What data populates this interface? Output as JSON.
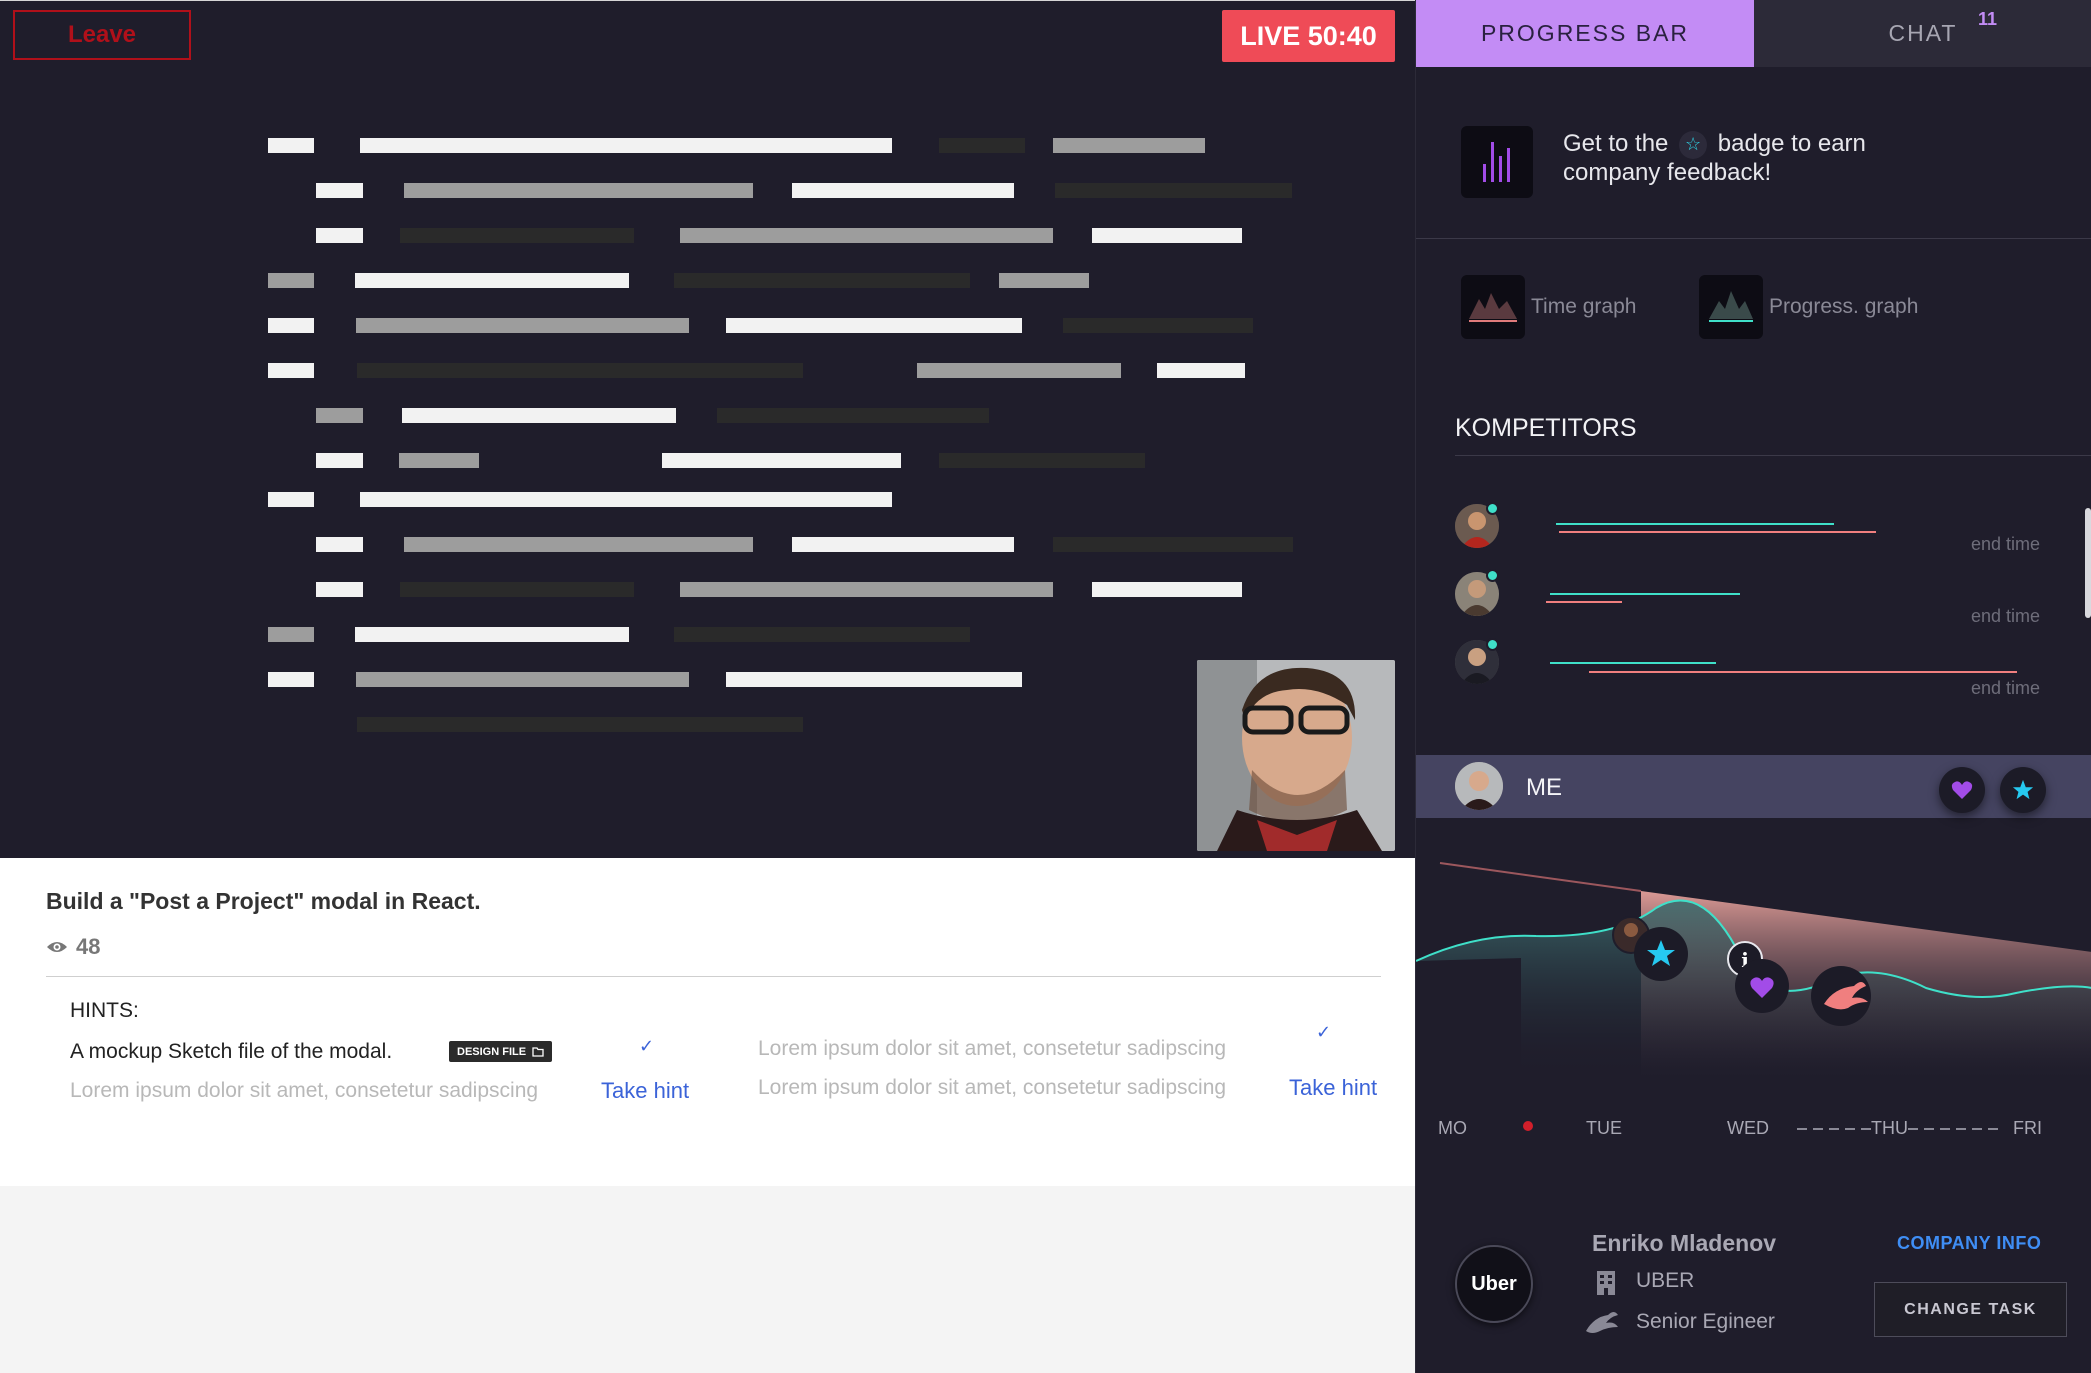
{
  "header": {
    "leave_label": "Leave",
    "live_label": "LIVE 50:40"
  },
  "task": {
    "title": "Build a \"Post a Project\" modal in React.",
    "views": "48",
    "hints_label": "HINTS:",
    "hint_main": "A mockup Sketch file of the modal.",
    "design_chip": "DESIGN FILE",
    "hint_muted_1": "Lorem ipsum dolor sit amet, consetetur sadipscing",
    "hint_muted_2": "Lorem ipsum dolor sit amet, consetetur sadipscing",
    "hint_muted_3": "Lorem ipsum dolor sit amet, consetetur sadipscing",
    "take_hint_1": "Take hint",
    "take_hint_2": "Take hint"
  },
  "sidebar": {
    "tabs": [
      {
        "label": "PROGRESS BAR"
      },
      {
        "label": "CHAT",
        "count": "11"
      }
    ],
    "promo_before": "Get to the",
    "promo_after": "badge to earn company feedback!",
    "graphs": [
      {
        "label": "Time graph"
      },
      {
        "label": "Progress. graph"
      }
    ],
    "competitors_title": "KOMPETITORS",
    "competitors": [
      {
        "end_label": "end time"
      },
      {
        "end_label": "end time"
      },
      {
        "end_label": "end time"
      }
    ],
    "me_label": "ME",
    "days": [
      "MO",
      "TUE",
      "WED",
      "THU",
      "FRI"
    ],
    "profile": {
      "company_logo": "Uber",
      "name": "Enriko Mladenov",
      "company": "UBER",
      "role": "Senior Egineer",
      "company_info": "COMPANY INFO",
      "change_task": "CHANGE TASK"
    }
  },
  "colors": {
    "accent_purple": "#c38cf5",
    "live_red": "#ef4b57",
    "teal": "#3fe0c9",
    "salmon": "#f07f7f",
    "link_blue": "#3b63d8"
  },
  "icons": [
    "eye-icon",
    "folder-icon",
    "check-icon",
    "bar-chart-icon",
    "star-icon",
    "heart-icon",
    "building-icon",
    "phoenix-icon",
    "info-icon"
  ]
}
